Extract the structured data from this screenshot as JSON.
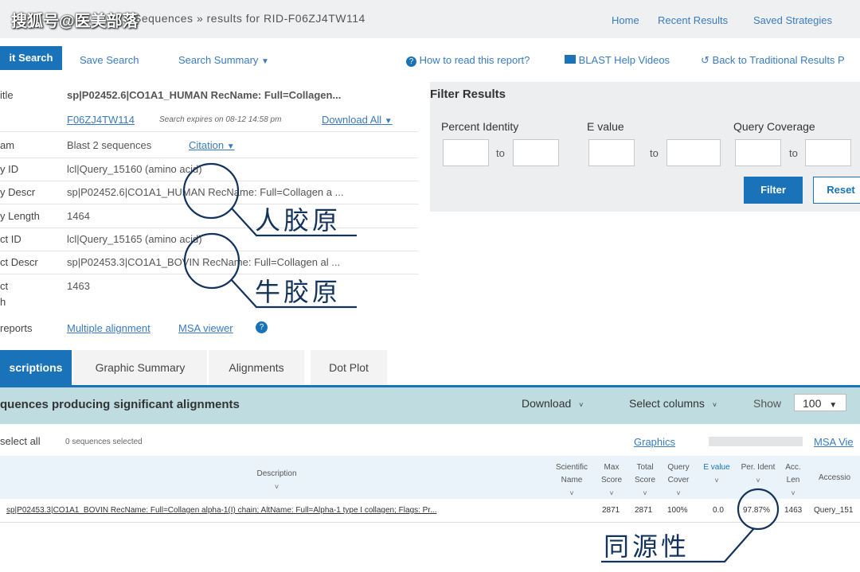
{
  "watermark": "搜狐号@医美部落",
  "header": {
    "title": "Sequences » results for RID-F06ZJ4TW114",
    "nav": [
      "Home",
      "Recent Results",
      "Saved Strategies"
    ]
  },
  "toolbar": {
    "edit_search": "it Search",
    "save_search": "Save Search",
    "search_summary": "Search Summary",
    "how_to_read": "How to read this report?",
    "help_videos": "BLAST Help Videos",
    "back_traditional": "Back to Traditional Results P"
  },
  "summary": {
    "rows": [
      {
        "label": "itle",
        "value": "sp|P02452.6|CO1A1_HUMAN RecName: Full=Collagen..."
      },
      {
        "label": "",
        "value": ""
      },
      {
        "label": "am",
        "value": "Blast 2 sequences"
      },
      {
        "label": "y ID",
        "value": "lcl|Query_15160 (amino acid)"
      },
      {
        "label": "y Descr",
        "value": "sp|P02452.6|CO1A1_HUMAN RecName: Full=Collagen a ..."
      },
      {
        "label": "y Length",
        "value": "1464"
      },
      {
        "label": "ct ID",
        "value": "lcl|Query_15165 (amino acid)"
      },
      {
        "label": "ct Descr",
        "value": "sp|P02453.3|CO1A1_BOVIN RecName: Full=Collagen al ..."
      },
      {
        "label": "ct",
        "value": "1463"
      },
      {
        "label": "h",
        "value": ""
      }
    ],
    "rid": "F06ZJ4TW114",
    "expires": "Search expires on 08-12 14:58 pm",
    "download_all": "Download All",
    "citation": "Citation",
    "other_reports_label": "reports",
    "multiple_alignment": "Multiple alignment",
    "msa_viewer": "MSA viewer"
  },
  "filter": {
    "title": "Filter Results",
    "percent_identity": "Percent Identity",
    "e_value": "E value",
    "query_coverage": "Query Coverage",
    "to": "to",
    "filter_btn": "Filter",
    "reset_btn": "Reset"
  },
  "tabs": [
    "scriptions",
    "Graphic Summary",
    "Alignments",
    "Dot Plot"
  ],
  "results": {
    "title": "quences producing significant alignments",
    "download": "Download",
    "select_columns": "Select columns",
    "show_label": "Show",
    "show_value": "100",
    "select_all": "select all",
    "selected_count": "0 sequences selected",
    "graphics": "Graphics",
    "msa_view": "MSA Vie"
  },
  "table": {
    "headers": [
      "Description",
      "Scientific Name",
      "Max Score",
      "Total Score",
      "Query Cover",
      "E value",
      "Per. Ident",
      "Acc. Len",
      "Accessio"
    ],
    "row": {
      "description": "sp|P02453.3|CO1A1_BOVIN RecName: Full=Collagen alpha-1(I) chain; AltName: Full=Alpha-1 type I collagen; Flags: Pr...",
      "scientific_name": "",
      "max_score": "2871",
      "total_score": "2871",
      "query_cover": "100%",
      "e_value": "0.0",
      "per_ident": "97.87%",
      "acc_len": "1463",
      "accession": "Query_151"
    }
  },
  "annotations": {
    "human": "人胶原",
    "bovine": "牛胶原",
    "homology": "同源性",
    "color": "#14335c"
  }
}
